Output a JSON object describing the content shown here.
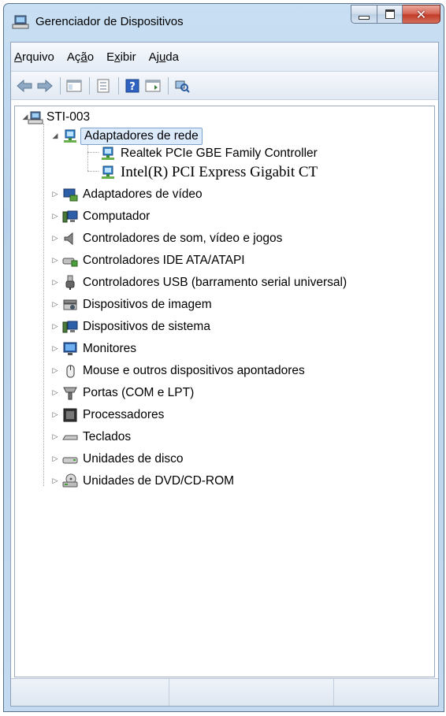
{
  "window": {
    "title": "Gerenciador de Dispositivos"
  },
  "menu": [
    {
      "pre": "",
      "acc": "A",
      "post": "rquivo"
    },
    {
      "pre": "Aç",
      "acc": "ã",
      "post": "o"
    },
    {
      "pre": "E",
      "acc": "x",
      "post": "ibir"
    },
    {
      "pre": "Aj",
      "acc": "u",
      "post": "da"
    }
  ],
  "tree": {
    "root": "STI-003",
    "network_adapters": "Adaptadores de rede",
    "network_children": [
      "Realtek PCIe GBE Family Controller",
      "Intel(R) PCI Express Gigabit CT"
    ],
    "categories": [
      "Adaptadores de vídeo",
      "Computador",
      "Controladores de som, vídeo e jogos",
      "Controladores IDE ATA/ATAPI",
      "Controladores USB (barramento serial universal)",
      "Dispositivos de imagem",
      "Dispositivos de sistema",
      "Monitores",
      "Mouse e outros dispositivos apontadores",
      "Portas (COM e LPT)",
      "Processadores",
      "Teclados",
      "Unidades de disco",
      "Unidades de DVD/CD-ROM"
    ]
  },
  "colors": {
    "selection": "#dcebfc",
    "close_button": "#c13c28",
    "frame": "#c4daf0"
  }
}
